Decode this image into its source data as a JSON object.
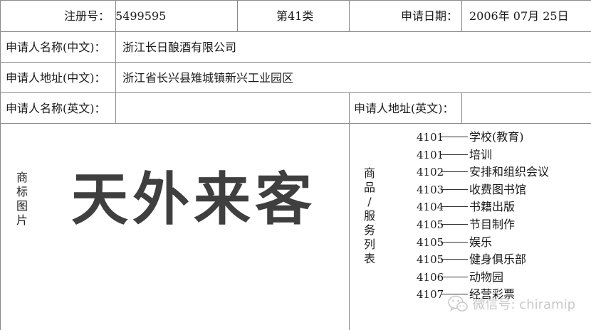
{
  "header": {
    "reg_label": "注册号：",
    "reg_number": "5499595",
    "class_label": "第41类",
    "date_label": "申请日期：",
    "date_value": "2006年 07月 25日"
  },
  "applicant": {
    "name_cn_label": "申请人名称(中文)：",
    "name_cn": "浙江长日酿酒有限公司",
    "addr_cn_label": "申请人地址(中文)：",
    "addr_cn": "浙江省长兴县雉城镇新兴工业园区",
    "name_en_label": "申请人名称(英文)：",
    "name_en": "",
    "addr_en_label": "申请人地址(英文)：",
    "addr_en": ""
  },
  "trademark": {
    "label_chars": [
      "商",
      "标",
      "图",
      "片"
    ],
    "mark_text": "天外来客"
  },
  "goods": {
    "label_chars": [
      "商",
      "品",
      "/",
      "服",
      "务",
      "列",
      "表"
    ],
    "items": [
      {
        "code": "4101",
        "name": "学校(教育)"
      },
      {
        "code": "4101",
        "name": "培训"
      },
      {
        "code": "4102",
        "name": "安排和组织会议"
      },
      {
        "code": "4103",
        "name": "收费图书馆"
      },
      {
        "code": "4104",
        "name": "书籍出版"
      },
      {
        "code": "4105",
        "name": "节目制作"
      },
      {
        "code": "4105",
        "name": "娱乐"
      },
      {
        "code": "4105",
        "name": "健身俱乐部"
      },
      {
        "code": "4106",
        "name": "动物园"
      },
      {
        "code": "4107",
        "name": "经营彩票"
      }
    ]
  },
  "watermark": {
    "text": "微信号: chiramip",
    "icon": "wechat-icon",
    "color": "#c9c9c9"
  }
}
